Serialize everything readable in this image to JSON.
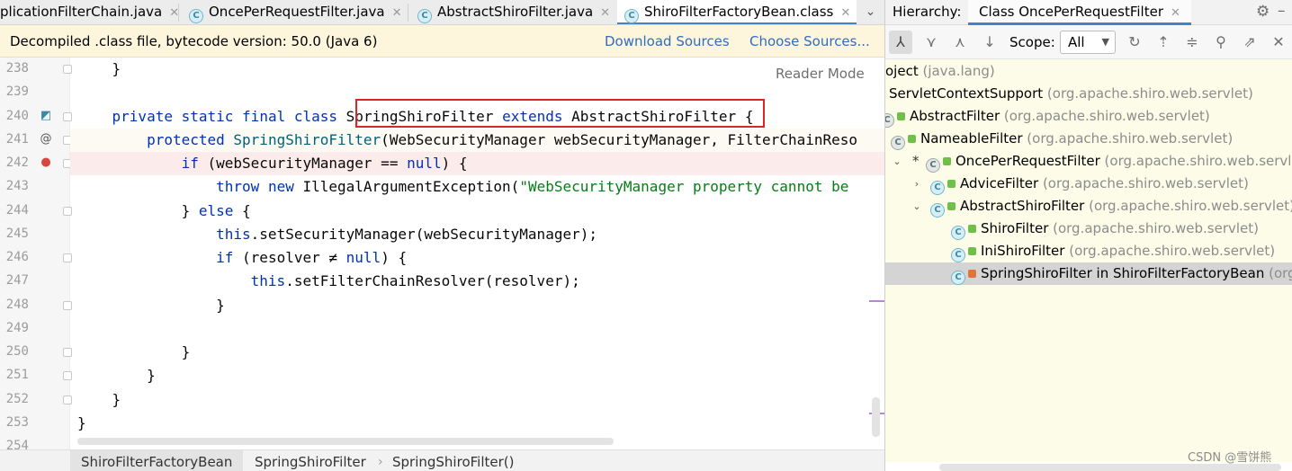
{
  "editor": {
    "tabs": [
      {
        "label": "plicationFilterChain.java",
        "active": false
      },
      {
        "label": "OncePerRequestFilter.java",
        "active": false
      },
      {
        "label": "AbstractShiroFilter.java",
        "active": false
      },
      {
        "label": "ShiroFilterFactoryBean.class",
        "active": true
      }
    ],
    "overflow_icon": "chevron-down-icon",
    "banner": {
      "text": "Decompiled .class file, bytecode version: 50.0 (Java 6)",
      "download_sources": "Download Sources",
      "choose_sources": "Choose Sources..."
    },
    "reader_mode": "Reader Mode",
    "lines": [
      {
        "num": "238",
        "code": "    }"
      },
      {
        "num": "239",
        "code": ""
      },
      {
        "num": "240",
        "code": "    private static final class SpringShiroFilter extends AbstractShiroFilter {"
      },
      {
        "num": "241",
        "code": "        protected SpringShiroFilter(WebSecurityManager webSecurityManager, FilterChainReso"
      },
      {
        "num": "242",
        "code": "            if (webSecurityManager == null) {"
      },
      {
        "num": "243",
        "code": "                throw new IllegalArgumentException(\"WebSecurityManager property cannot be"
      },
      {
        "num": "244",
        "code": "            } else {"
      },
      {
        "num": "245",
        "code": "                this.setSecurityManager(webSecurityManager);"
      },
      {
        "num": "246",
        "code": "                if (resolver ≠ null) {"
      },
      {
        "num": "247",
        "code": "                    this.setFilterChainResolver(resolver);"
      },
      {
        "num": "248",
        "code": "                }"
      },
      {
        "num": "249",
        "code": ""
      },
      {
        "num": "250",
        "code": "            }"
      },
      {
        "num": "251",
        "code": "        }"
      },
      {
        "num": "252",
        "code": "    }"
      },
      {
        "num": "253",
        "code": "}"
      },
      {
        "num": "254",
        "code": ""
      }
    ],
    "breadcrumb": [
      "ShiroFilterFactoryBean",
      "SpringShiroFilter",
      "SpringShiroFilter()"
    ]
  },
  "hierarchy": {
    "label": "Hierarchy:",
    "tab": "Class OncePerRequestFilter",
    "scope_label": "Scope:",
    "scope_value": "All",
    "tree": [
      {
        "name": "oject",
        "pkg": " (java.lang)",
        "indent": 0,
        "arrow": "",
        "icon": false
      },
      {
        "name": "ServletContextSupport",
        "pkg": " (org.apache.shiro.web.servlet)",
        "indent": 4,
        "arrow": "",
        "icon": false
      },
      {
        "name": "AbstractFilter",
        "pkg": " (org.apache.shiro.web.servlet)",
        "indent": 14,
        "arrow": "",
        "icon": "abstract-partial"
      },
      {
        "name": "NameableFilter",
        "pkg": " (org.apache.shiro.web.servlet)",
        "indent": 36,
        "arrow": "",
        "icon": "abstract"
      },
      {
        "name": "OncePerRequestFilter",
        "pkg": " (org.apache.shiro.web.servl",
        "indent": 74,
        "arrow": "down",
        "star": true,
        "icon": "abstract"
      },
      {
        "name": "AdviceFilter",
        "pkg": " (org.apache.shiro.web.servlet)",
        "indent": 80,
        "arrow": "right",
        "icon": "class"
      },
      {
        "name": "AbstractShiroFilter",
        "pkg": " (org.apache.shiro.web.servlet)",
        "indent": 80,
        "arrow": "down",
        "icon": "class"
      },
      {
        "name": "ShiroFilter",
        "pkg": " (org.apache.shiro.web.servlet)",
        "indent": 103,
        "arrow": "",
        "icon": "class"
      },
      {
        "name": "IniShiroFilter",
        "pkg": " (org.apache.shiro.web.servlet)",
        "indent": 103,
        "arrow": "",
        "icon": "class"
      },
      {
        "name": "SpringShiroFilter in ShiroFilterFactoryBean",
        "pkg": " (org",
        "indent": 103,
        "arrow": "",
        "icon": "class-private",
        "selected": true
      }
    ]
  },
  "watermark": "CSDN @雪饼熊"
}
